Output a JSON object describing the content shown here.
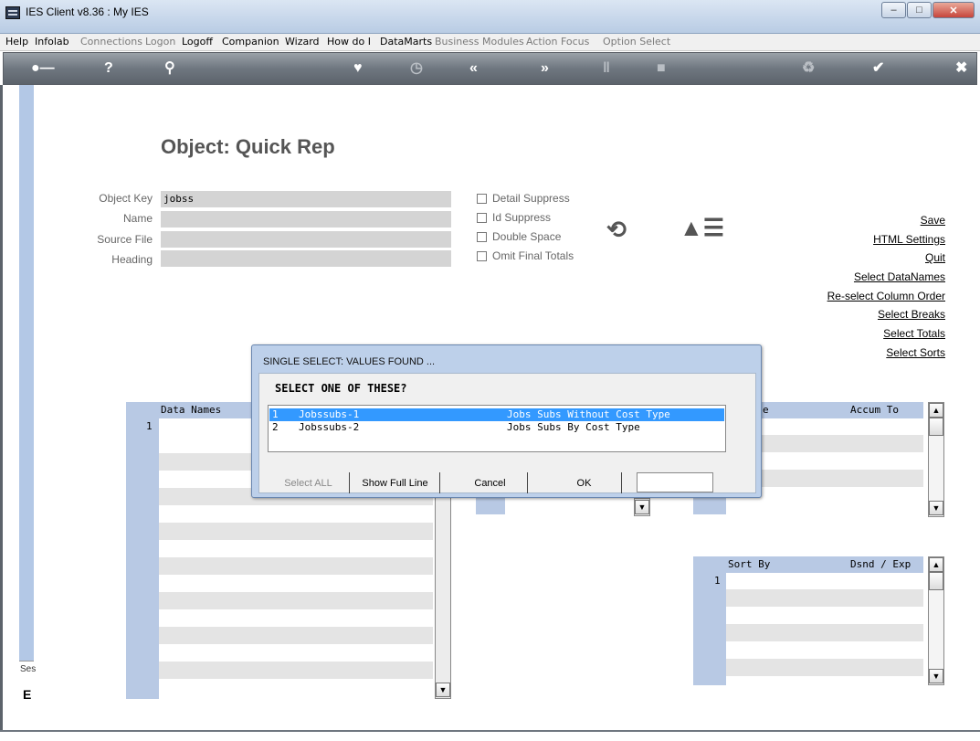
{
  "window": {
    "title": "IES Client v8.36 : My IES"
  },
  "menu": [
    "Help",
    "Infolab",
    "Connections",
    "Logon",
    "Logoff",
    "Companion",
    "Wizard",
    "How do I",
    "DataMarts",
    "Business Modules",
    "Action Focus",
    "Option Select"
  ],
  "page": {
    "title": "Object: Quick Rep",
    "session_label": "Ses",
    "session_mark": "E"
  },
  "form": {
    "object_key_label": "Object Key",
    "object_key_value": "jobss",
    "name_label": "Name",
    "source_file_label": "Source File",
    "heading_label": "Heading"
  },
  "options": [
    "Detail Suppress",
    "Id Suppress",
    "Double Space",
    "Omit Final Totals"
  ],
  "links": [
    "Save",
    "HTML Settings",
    "Quit",
    "Select DataNames",
    "Re-select Column Order",
    "Select Breaks",
    "Select Totals",
    "Select Sorts"
  ],
  "grids": {
    "data_names_header": "Data Names",
    "accum_header_partial": "e",
    "accum_to_header": "Accum To",
    "sort_by_header": "Sort By",
    "dsnd_header": "Dsnd / Exp",
    "row1": "1"
  },
  "dialog": {
    "title": "SINGLE SELECT: VALUES FOUND ...",
    "prompt": "SELECT ONE OF THESE?",
    "items": [
      {
        "num": "1",
        "code": "Jobssubs-1",
        "desc": "Jobs Subs Without Cost Type"
      },
      {
        "num": "2",
        "code": "Jobssubs-2",
        "desc": "Jobs Subs By Cost Type"
      }
    ],
    "buttons": {
      "select_all": "Select ALL",
      "show_full_line": "Show Full Line",
      "cancel": "Cancel",
      "ok": "OK"
    }
  },
  "icons": {
    "toolbar": [
      "key-icon",
      "help-icon",
      "search-icon",
      "heart-icon",
      "clock-icon",
      "rewind-icon",
      "forward-icon",
      "pause-icon",
      "stop-icon",
      "recycle-icon",
      "check-icon",
      "close-icon"
    ],
    "refresh": "refresh-icon",
    "fire": "fire-icon"
  },
  "colors": {
    "selection": "#3399ff",
    "grid_header": "#b8c9e4",
    "dialog_frame": "#bdd0ea"
  }
}
